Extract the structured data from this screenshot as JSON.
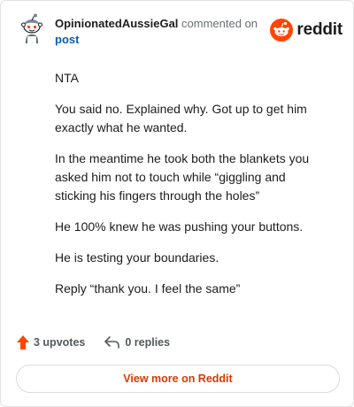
{
  "comment": {
    "username": "OpinionatedAussieGal",
    "action_text": "commented on",
    "post_link": "post",
    "paragraphs": [
      "NTA",
      "You said no. Explained why. Got up to get him exactly what he wanted.",
      "In the meantime he took both the blankets you asked him not to touch while “giggling and sticking his fingers through the holes”",
      "He 100% knew he was pushing your buttons.",
      "He is testing your boundaries.",
      "Reply “thank you. I feel the same”"
    ]
  },
  "brand": {
    "name": "reddit",
    "color": "#ff4500"
  },
  "footer": {
    "upvotes": "3 upvotes",
    "replies": "0 replies",
    "upvote_icon": "upvote-arrow-icon",
    "reply_icon": "reply-arrow-icon",
    "upvote_color": "#ff4500"
  },
  "view_more": {
    "label": "View more on Reddit",
    "color": "#d93a00"
  }
}
